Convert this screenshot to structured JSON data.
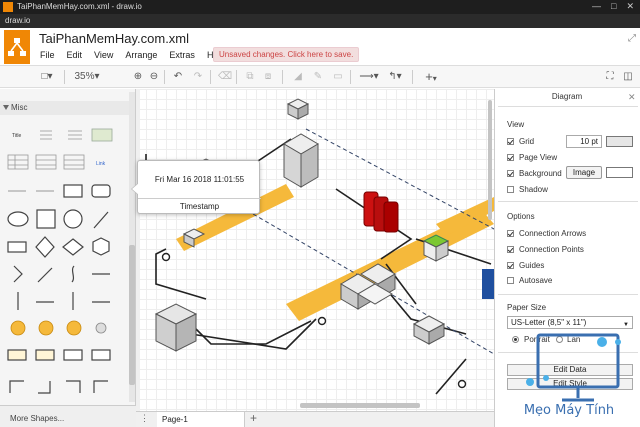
{
  "window": {
    "title": "TaiPhanMemHay.com.xml - draw.io",
    "app_menu": "draw.io"
  },
  "header": {
    "doc_title": "TaiPhanMemHay.com.xml",
    "menus": [
      "File",
      "Edit",
      "View",
      "Arrange",
      "Extras",
      "Help"
    ],
    "unsaved_notice": "Unsaved changes. Click here to save."
  },
  "toolbar": {
    "zoom": "35%",
    "icons": [
      "page-view-icon",
      "zoom-in-icon",
      "zoom-out-icon",
      "undo-icon",
      "redo-icon",
      "delete-icon",
      "to-front-icon",
      "to-back-icon",
      "fill-color-icon",
      "line-color-icon",
      "shadow-icon",
      "connection-icon",
      "waypoints-icon",
      "insert-icon",
      "fullscreen-icon",
      "format-panel-icon"
    ]
  },
  "sidebar": {
    "section": "Misc",
    "more_shapes": "More Shapes...",
    "mini_labels": [
      "Title",
      "Link"
    ]
  },
  "tooltip": {
    "timestamp_value": "Fri Mar 16 2018 11:01:55",
    "label": "Timestamp"
  },
  "pages": {
    "current": "Page-1"
  },
  "format_panel": {
    "title": "Diagram",
    "view_section": "View",
    "grid": {
      "label": "Grid",
      "checked": true,
      "size": "10 pt"
    },
    "page_view": {
      "label": "Page View",
      "checked": true
    },
    "background": {
      "label": "Background",
      "checked": true,
      "button": "Image"
    },
    "shadow": {
      "label": "Shadow",
      "checked": false
    },
    "options_section": "Options",
    "connection_arrows": {
      "label": "Connection Arrows",
      "checked": true
    },
    "connection_points": {
      "label": "Connection Points",
      "checked": true
    },
    "guides": {
      "label": "Guides",
      "checked": true
    },
    "autosave": {
      "label": "Autosave",
      "checked": false
    },
    "paper_section": "Paper Size",
    "paper_size": "US-Letter (8,5\" x 11\")",
    "portrait": "Portrait",
    "landscape": "Lan",
    "edit_data": "Edit Data",
    "edit_style": "Edit Style"
  },
  "watermark": {
    "text": "Mẹo Máy Tính"
  },
  "colors": {
    "accent_orange": "#f08705",
    "path_yellow": "#f5b93b",
    "server_red": "#cc1111",
    "node_green": "#7cc832",
    "unsaved_bg": "#f2dede"
  }
}
